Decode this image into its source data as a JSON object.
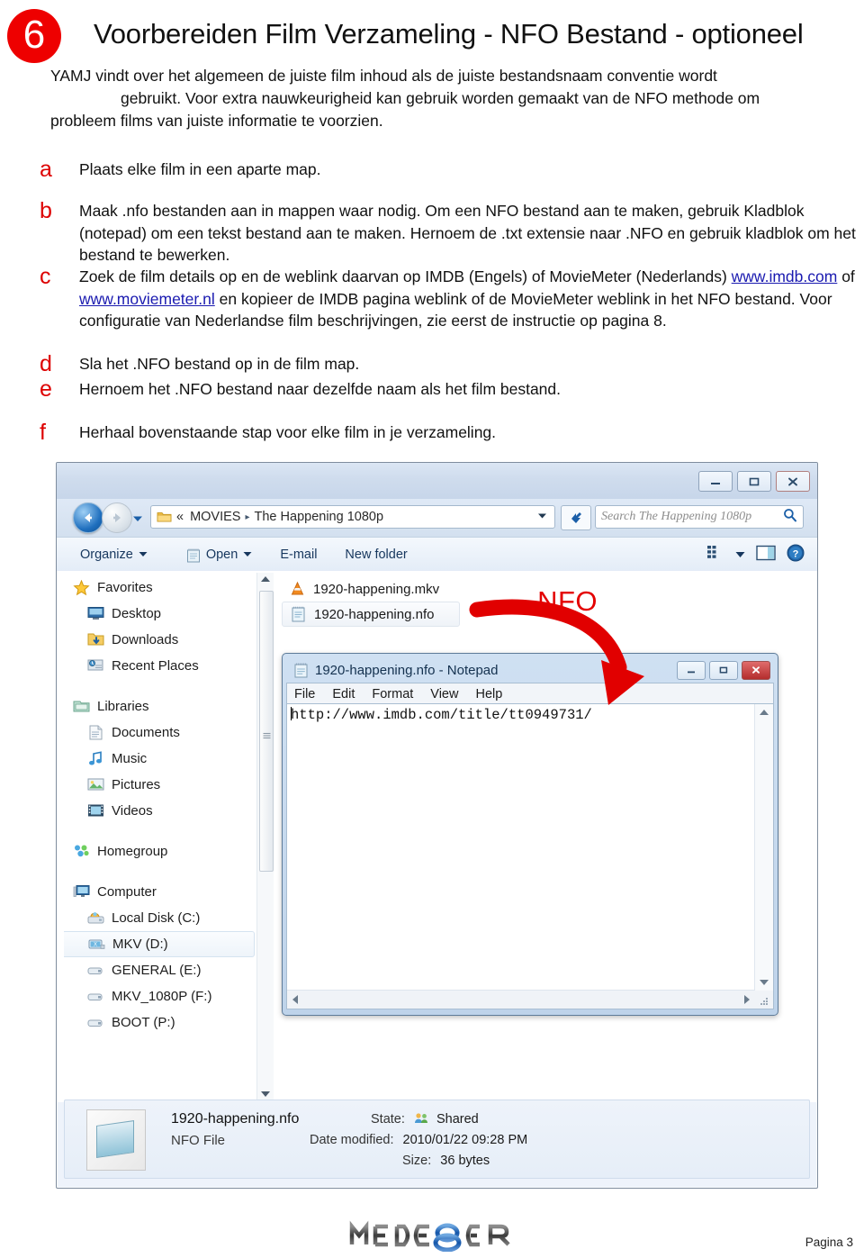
{
  "header": {
    "step_number": "6",
    "title": "Voorbereiden Film Verzameling - NFO Bestand - optioneel",
    "accent_color": "#ee0000"
  },
  "intro": {
    "line1": "YAMJ vindt over het algemeen de juiste film inhoud als de juiste bestandsnaam conventie wordt",
    "line2": "gebruikt. Voor extra nauwkeurigheid kan gebruik worden gemaakt van de NFO methode om",
    "line3": "probleem films van juiste informatie te voorzien."
  },
  "steps": [
    {
      "letter": "a",
      "text": "Plaats elke film in een aparte map."
    },
    {
      "letter": "b",
      "text": "Maak .nfo bestanden aan in mappen waar nodig. Om een NFO bestand aan te maken, gebruik Kladblok (notepad) om een tekst bestand aan te maken. Hernoem de .txt extensie naar .NFO en gebruik kladblok om het bestand te bewerken."
    },
    {
      "letter": "c",
      "text_before": "Zoek de film details op en de weblink daarvan op IMDB (Engels) of MovieMeter (Nederlands) ",
      "link1": "www.imdb.com",
      "between": " of  ",
      "link2": "www.moviemeter.nl",
      "text_after": " en kopieer de IMDB pagina weblink of de MovieMeter weblink in het NFO bestand. Voor configuratie van Nederlandse film beschrijvingen, zie eerst de instructie op pagina 8."
    },
    {
      "letter": "d",
      "text": "Sla het .NFO bestand op in de film map."
    },
    {
      "letter": "e",
      "text": "Hernoem het .NFO bestand naar dezelfde naam als het film bestand."
    },
    {
      "letter": "f",
      "text": "Herhaal bovenstaande stap voor elke film in je verzameling."
    }
  ],
  "explorer": {
    "address": {
      "overflow": "«",
      "crumb1": "MOVIES",
      "separator": "▸",
      "crumb2": "The Happening 1080p"
    },
    "search_placeholder": "Search The Happening 1080p",
    "window_buttons": {
      "minimize": "minimize-button",
      "maximize": "maximize-button",
      "close": "close-button"
    },
    "toolbar": {
      "organize": "Organize",
      "open": "Open",
      "email": "E-mail",
      "new_folder": "New folder"
    },
    "nav_groups": [
      {
        "root": "Favorites",
        "icon": "star-icon",
        "children": [
          {
            "label": "Desktop",
            "icon": "desktop-icon"
          },
          {
            "label": "Downloads",
            "icon": "downloads-folder-icon"
          },
          {
            "label": "Recent Places",
            "icon": "recent-places-icon"
          }
        ]
      },
      {
        "root": "Libraries",
        "icon": "libraries-icon",
        "children": [
          {
            "label": "Documents",
            "icon": "documents-icon"
          },
          {
            "label": "Music",
            "icon": "music-note-icon"
          },
          {
            "label": "Pictures",
            "icon": "pictures-icon"
          },
          {
            "label": "Videos",
            "icon": "videos-film-icon"
          }
        ]
      },
      {
        "root": "Homegroup",
        "icon": "homegroup-icon",
        "children": []
      },
      {
        "root": "Computer",
        "icon": "computer-icon",
        "children": [
          {
            "label": "Local Disk (C:)",
            "icon": "system-drive-icon",
            "selected": false
          },
          {
            "label": "MKV (D:)",
            "icon": "drive-icon",
            "selected": true
          },
          {
            "label": "GENERAL (E:)",
            "icon": "drive-icon",
            "selected": false
          },
          {
            "label": "MKV_1080P (F:)",
            "icon": "drive-icon",
            "selected": false
          },
          {
            "label": "BOOT (P:)",
            "icon": "drive-icon",
            "selected": false
          }
        ]
      }
    ],
    "files": [
      {
        "name": "1920-happening.mkv",
        "icon": "vlc-media-icon",
        "selected": false
      },
      {
        "name": "1920-happening.nfo",
        "icon": "notepad-file-icon",
        "selected": true
      }
    ],
    "details": {
      "file_name": "1920-happening.nfo",
      "file_type": "NFO File",
      "state_label": "State:",
      "state_value": "Shared",
      "date_label": "Date modified:",
      "date_value": "2010/01/22 09:28 PM",
      "size_label": "Size:",
      "size_value": "36 bytes"
    }
  },
  "notepad": {
    "title": "1920-happening.nfo - Notepad",
    "menu": [
      "File",
      "Edit",
      "Format",
      "View",
      "Help"
    ],
    "content": "http://www.imdb.com/title/tt0949731/"
  },
  "callout": {
    "label": ".NFO",
    "color": "#e40000"
  },
  "footer": {
    "logo_text": "MEDE8ER",
    "page": "Pagina 3"
  }
}
